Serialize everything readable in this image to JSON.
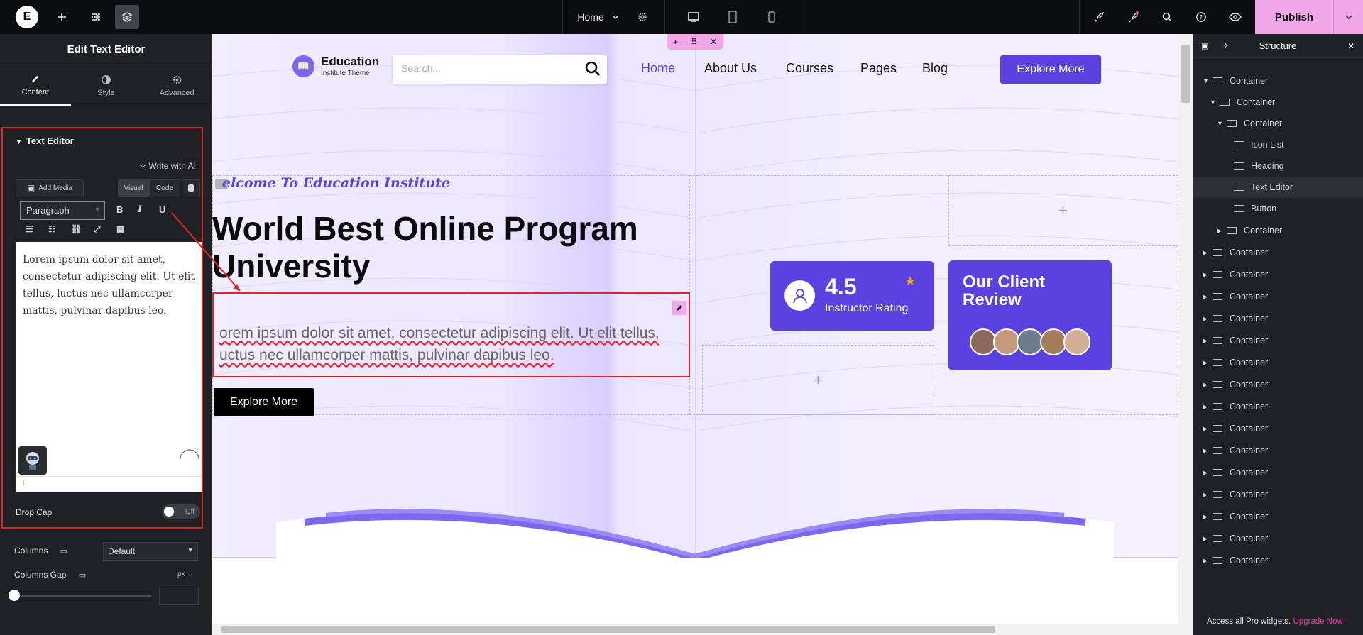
{
  "topbar": {
    "logo": "E",
    "page_selector": "Home",
    "publish_label": "Publish"
  },
  "left_panel": {
    "title": "Edit Text Editor",
    "tabs": [
      {
        "label": "Content",
        "icon": "pencil-icon",
        "active": true
      },
      {
        "label": "Style",
        "icon": "contrast-icon",
        "active": false
      },
      {
        "label": "Advanced",
        "icon": "gear-icon",
        "active": false
      }
    ],
    "section_title": "Text Editor",
    "ai_link": "Write with AI",
    "add_media": "Add Media",
    "mode_visual": "Visual",
    "mode_code": "Code",
    "format_select": "Paragraph",
    "editor_text": "Lorem ipsum dolor sit amet, consectetur adipiscing elit. Ut elit tellus, luctus nec ullamcorper mattis, pulvinar dapibus leo.",
    "editor_status": "p",
    "drop_cap_label": "Drop Cap",
    "drop_cap_state": "Off",
    "columns_label": "Columns",
    "columns_value": "Default",
    "columns_gap_label": "Columns Gap",
    "columns_gap_unit": "px"
  },
  "site": {
    "logo_title": "Education",
    "logo_subtitle": "Institute Theme",
    "search_placeholder": "Search...",
    "nav": [
      "Home",
      "About Us",
      "Courses",
      "Pages",
      "Blog"
    ],
    "cta": "Explore More",
    "welcome": "elcome To Education Institute",
    "hero_title": "World Best Online Program University",
    "hero_text": "orem ipsum dolor sit amet, consectetur adipiscing elit. Ut elit tellus, uctus nec ullamcorper mattis, pulvinar dapibus leo.",
    "hero_button": "Explore More",
    "rating_value": "4.5",
    "rating_label": "Instructor Rating",
    "review_title": "Our Client Review"
  },
  "colors": {
    "brand": "#5b41e0",
    "publish": "#f0a8e8",
    "highlight": "#e3242b"
  },
  "structure": {
    "title": "Structure",
    "items": [
      {
        "label": "Container",
        "depth": 0,
        "expanded": true
      },
      {
        "label": "Container",
        "depth": 1,
        "expanded": true
      },
      {
        "label": "Container",
        "depth": 2,
        "expanded": true
      },
      {
        "label": "Icon List",
        "depth": 3
      },
      {
        "label": "Heading",
        "depth": 3
      },
      {
        "label": "Text Editor",
        "depth": 3,
        "selected": true
      },
      {
        "label": "Button",
        "depth": 3
      },
      {
        "label": "Container",
        "depth": 2
      },
      {
        "label": "Container",
        "depth": 0
      },
      {
        "label": "Container",
        "depth": 0
      },
      {
        "label": "Container",
        "depth": 0
      },
      {
        "label": "Container",
        "depth": 0
      },
      {
        "label": "Container",
        "depth": 0
      },
      {
        "label": "Container",
        "depth": 0
      },
      {
        "label": "Container",
        "depth": 0
      },
      {
        "label": "Container",
        "depth": 0
      },
      {
        "label": "Container",
        "depth": 0
      },
      {
        "label": "Container",
        "depth": 0
      },
      {
        "label": "Container",
        "depth": 0
      },
      {
        "label": "Container",
        "depth": 0
      },
      {
        "label": "Container",
        "depth": 0
      },
      {
        "label": "Container",
        "depth": 0
      },
      {
        "label": "Container",
        "depth": 0
      }
    ],
    "footer_text": "Access all Pro widgets.",
    "footer_link": "Upgrade Now"
  }
}
